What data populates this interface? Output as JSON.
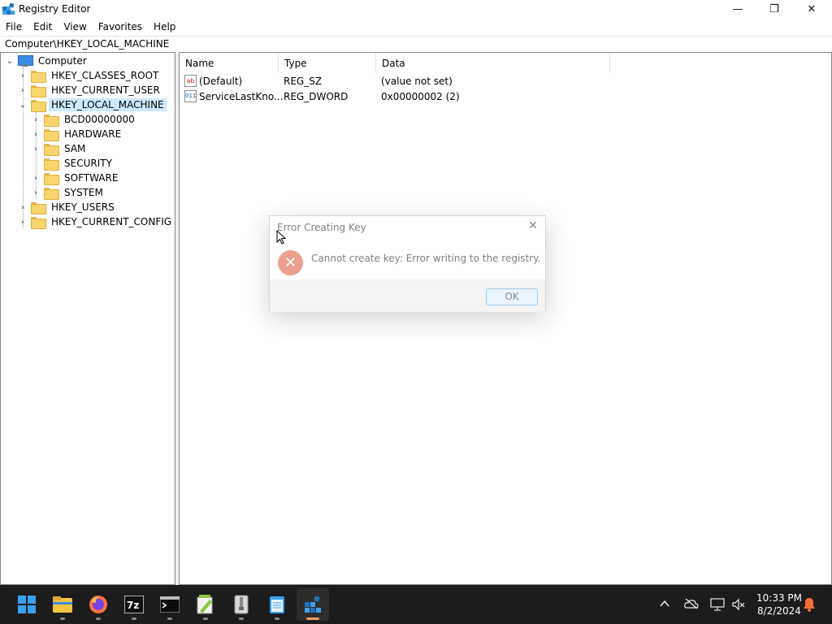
{
  "window": {
    "title": "Registry Editor",
    "controls": {
      "minimize": "—",
      "maximize": "❐",
      "close": "✕"
    }
  },
  "menu": [
    "File",
    "Edit",
    "View",
    "Favorites",
    "Help"
  ],
  "address": "Computer\\HKEY_LOCAL_MACHINE",
  "tree": {
    "root": "Computer",
    "items": [
      {
        "label": "HKEY_CLASSES_ROOT",
        "level": 1,
        "expanded": false
      },
      {
        "label": "HKEY_CURRENT_USER",
        "level": 1,
        "expanded": false
      },
      {
        "label": "HKEY_LOCAL_MACHINE",
        "level": 1,
        "expanded": true,
        "selected": true
      },
      {
        "label": "BCD00000000",
        "level": 2,
        "expanded": false
      },
      {
        "label": "HARDWARE",
        "level": 2,
        "expanded": false
      },
      {
        "label": "SAM",
        "level": 2,
        "expanded": false
      },
      {
        "label": "SECURITY",
        "level": 2,
        "expanded": false,
        "leaf": true
      },
      {
        "label": "SOFTWARE",
        "level": 2,
        "expanded": false
      },
      {
        "label": "SYSTEM",
        "level": 2,
        "expanded": false
      },
      {
        "label": "HKEY_USERS",
        "level": 1,
        "expanded": false
      },
      {
        "label": "HKEY_CURRENT_CONFIG",
        "level": 1,
        "expanded": false
      }
    ]
  },
  "values": {
    "columns": [
      "Name",
      "Type",
      "Data"
    ],
    "rows": [
      {
        "icon": "ab",
        "name": "(Default)",
        "type": "REG_SZ",
        "data": "(value not set)"
      },
      {
        "icon": "011",
        "name": "ServiceLastKno...",
        "type": "REG_DWORD",
        "data": "0x00000002 (2)"
      }
    ]
  },
  "dialog": {
    "title": "Error Creating Key",
    "message": "Cannot create key: Error writing to the registry.",
    "ok_label": "OK",
    "close_glyph": "✕",
    "error_glyph": "✕"
  },
  "taskbar": {
    "apps": [
      "start-menu",
      "file-explorer",
      "firefox",
      "7-zip",
      "terminal",
      "notepad-plus-plus",
      "archive-manager",
      "notepad",
      "registry-editor"
    ],
    "time": "10:33 PM",
    "date": "8/2/2024"
  },
  "colors": {
    "selection": "#cce8ff",
    "error": "#e8907a",
    "taskbar": "#1c1c1c",
    "accent": "#0078d4"
  }
}
